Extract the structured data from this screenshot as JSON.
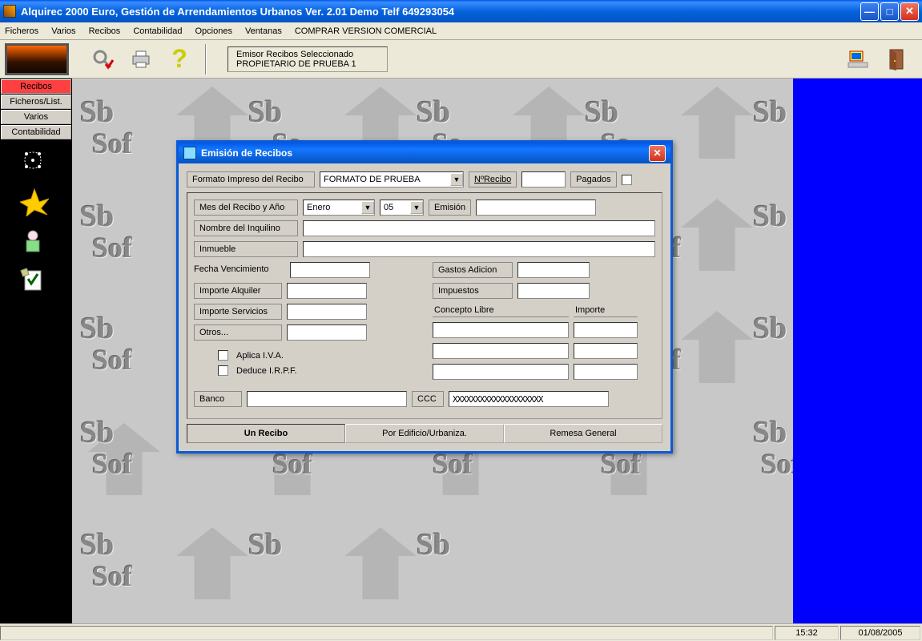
{
  "app_title": "Alquirec 2000 Euro, Gestión de Arrendamientos Urbanos Ver. 2.01 Demo Telf 649293054",
  "menu": [
    "Ficheros",
    "Varios",
    "Recibos",
    "Contabilidad",
    "Opciones",
    "Ventanas",
    "COMPRAR VERSION COMERCIAL"
  ],
  "toolbar": {
    "emisor_l1": "Emisor Recibos Seleccionado",
    "emisor_l2": "PROPIETARIO DE PRUEBA 1"
  },
  "sidebar": {
    "buttons": [
      "Recibos",
      "Ficheros/List.",
      "Varios",
      "Contabilidad"
    ],
    "active_index": 0
  },
  "dialog": {
    "title": "Emisión de Recibos",
    "formato_label": "Formato Impreso del Recibo",
    "formato_value": "FORMATO DE PRUEBA",
    "nrecibo_label": "NºRecibo",
    "nrecibo_value": "",
    "pagados_label": "Pagados",
    "mes_label": "Mes del Recibo y Año",
    "mes_value": "Enero",
    "ano_value": "05",
    "emision_label": "Emisión",
    "emision_value": "",
    "nombre_label": "Nombre del Inquilino",
    "nombre_value": "",
    "inmueble_label": "Inmueble",
    "inmueble_value": "",
    "fecha_venc_label": "Fecha Vencimiento",
    "fecha_venc_value": "",
    "imp_alq_label": "Importe Alquiler",
    "imp_alq_value": "",
    "imp_serv_label": "Importe Servicios",
    "imp_serv_value": "",
    "otros_label": "Otros...",
    "otros_value": "",
    "iva_label": "Aplica I.V.A.",
    "irpf_label": "Deduce I.R.P.F.",
    "gastos_label": "Gastos Adicion",
    "gastos_value": "",
    "impuestos_label": "Impuestos",
    "impuestos_value": "",
    "concepto_libre_label": "Concepto Libre",
    "importe_label": "Importe",
    "banco_label": "Banco",
    "banco_value": "",
    "ccc_label": "CCC",
    "ccc_value": "XXXXXXXXXXXXXXXXXXXX",
    "tabs": [
      "Un Recibo",
      "Por Edificio/Urbaniza.",
      "Remesa General"
    ],
    "active_tab": 0
  },
  "statusbar": {
    "time": "15:32",
    "date": "01/08/2005"
  }
}
